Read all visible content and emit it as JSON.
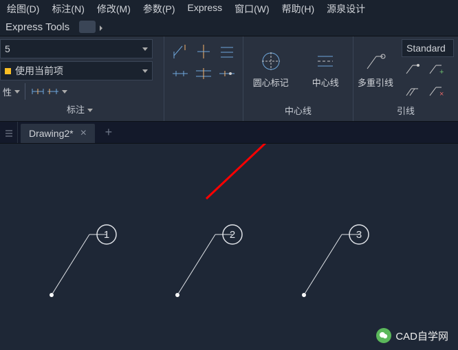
{
  "menu": {
    "draw": "绘图(D)",
    "dim": "标注(N)",
    "modify": "修改(M)",
    "param": "参数(P)",
    "express": "Express",
    "window": "窗口(W)",
    "help": "帮助(H)",
    "yuanquan": "源泉设计"
  },
  "toolbar": {
    "express": "Express Tools"
  },
  "ribbon": {
    "dimscale": {
      "value": "5"
    },
    "dimstyle": {
      "value": "使用当前项",
      "label_prop": "性"
    },
    "panel_dim_label": "标注",
    "panel_center_label": "中心线",
    "circle_mark": "圆心标记",
    "center_line": "中心线",
    "panel_leader_label": "引线",
    "multileader": "多重引线",
    "leader_style": "Standard"
  },
  "tabs": {
    "file": "Drawing2*"
  },
  "leaders": {
    "items": [
      {
        "n": "1"
      },
      {
        "n": "2"
      },
      {
        "n": "3"
      }
    ]
  },
  "watermark": {
    "text": "CAD自学网"
  }
}
